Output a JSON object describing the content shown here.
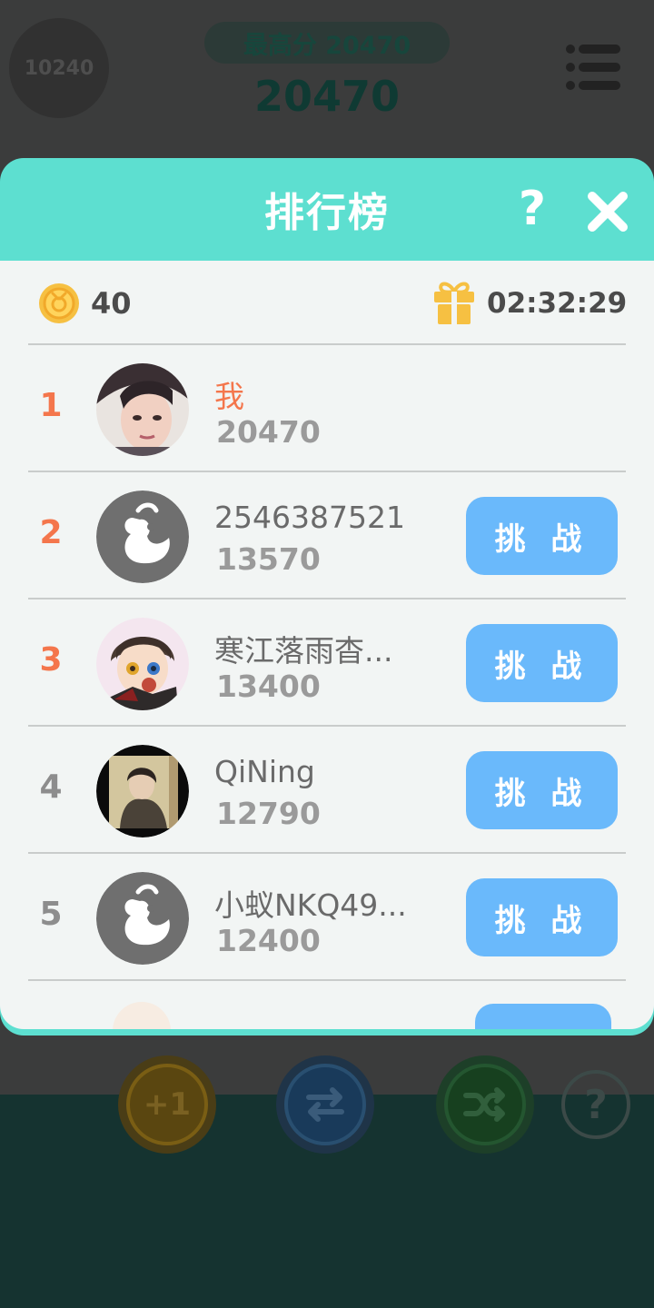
{
  "game": {
    "target_tile": "10240",
    "best_score_label": "最高分 20470",
    "current_score": "20470",
    "tools": {
      "plus_one": "+1",
      "help": "?"
    }
  },
  "leaderboard": {
    "title": "排行榜",
    "help_label": "?",
    "coins": "40",
    "timer": "02:32:29",
    "challenge_label": "挑 战",
    "entries": [
      {
        "rank": "1",
        "name": "我",
        "score": "20470"
      },
      {
        "rank": "2",
        "name": "2546387521",
        "score": "13570"
      },
      {
        "rank": "3",
        "name": "寒江落雨杳...",
        "score": "13400"
      },
      {
        "rank": "4",
        "name": "QiNing",
        "score": "12790"
      },
      {
        "rank": "5",
        "name": "小蚁NKQ49...",
        "score": "12400"
      }
    ]
  },
  "colors": {
    "header": "#5ddfd0",
    "rank_top": "#f4764c",
    "challenge": "#6ab9fb"
  }
}
